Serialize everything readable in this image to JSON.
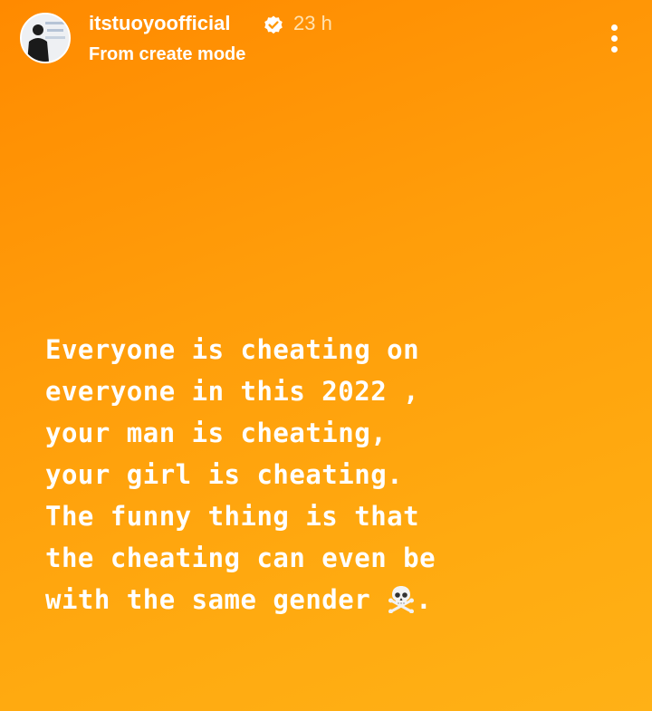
{
  "story": {
    "username": "itstuoyoofficial",
    "time_ago": "23 h",
    "subtitle": "From create mode",
    "icons": {
      "verified": "verified-badge-icon",
      "menu": "more-vertical-icon",
      "emoji": "skull-crossbones-icon"
    },
    "colors": {
      "background_start": "#ff8a00",
      "background_end": "#ffb116",
      "text": "#ffffff"
    }
  },
  "caption": {
    "lines": [
      "Everyone is cheating on",
      "everyone in this 2022 ,",
      "your man is cheating,",
      "your girl is cheating.",
      "The funny thing is that",
      "the cheating can even be",
      "with the same gender"
    ],
    "trailing": "."
  }
}
